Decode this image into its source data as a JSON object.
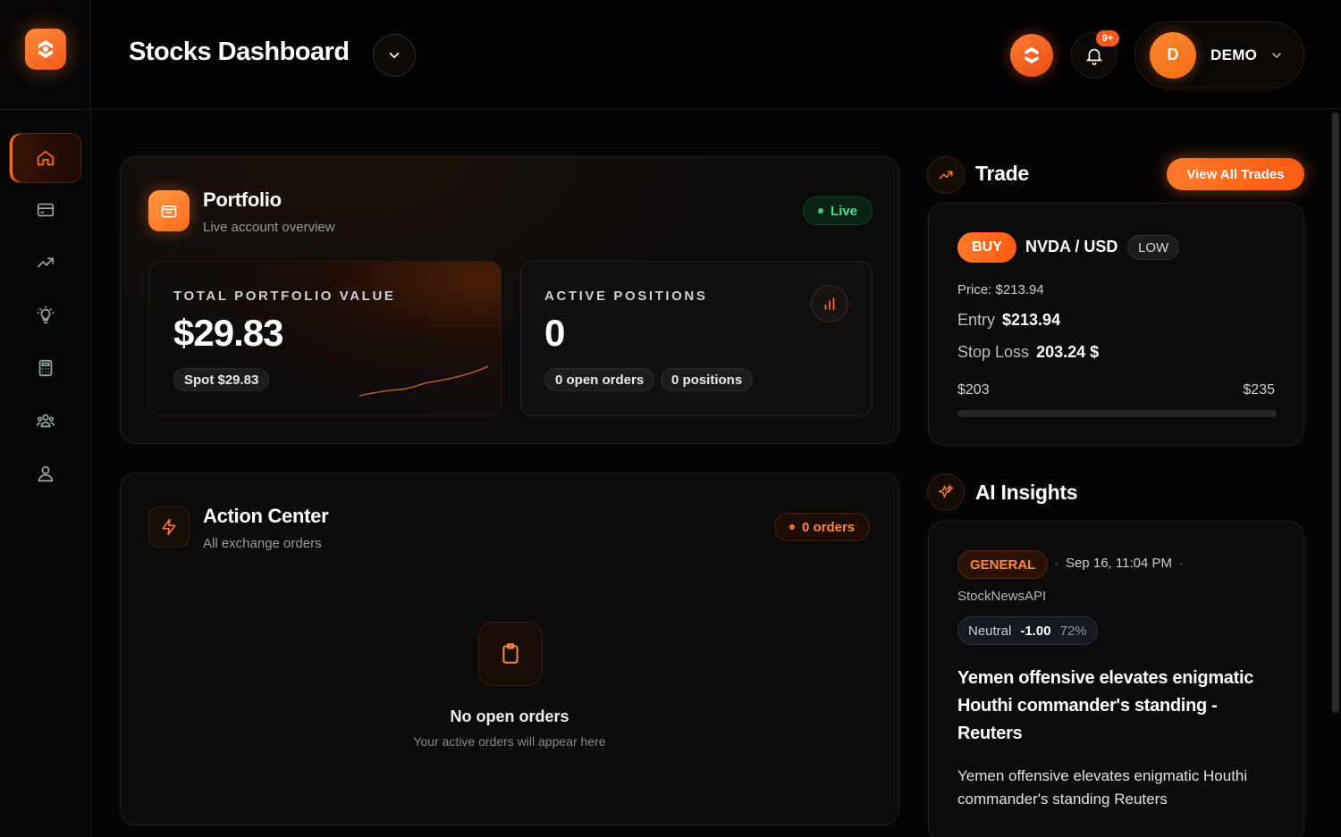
{
  "header": {
    "title": "Stocks Dashboard",
    "notifications_badge": "9+",
    "user": {
      "initial": "D",
      "name": "DEMO"
    }
  },
  "sidebar": {
    "items": [
      {
        "name": "home",
        "icon": "home-icon",
        "active": true
      },
      {
        "name": "cards",
        "icon": "credit-card-icon"
      },
      {
        "name": "trades",
        "icon": "trending-up-icon"
      },
      {
        "name": "insights",
        "icon": "lightbulb-icon"
      },
      {
        "name": "calculator",
        "icon": "calculator-icon"
      },
      {
        "name": "community",
        "icon": "users-icon"
      },
      {
        "name": "profile",
        "icon": "user-icon"
      }
    ]
  },
  "portfolio": {
    "title": "Portfolio",
    "subtitle": "Live account overview",
    "status": "Live",
    "total": {
      "label": "TOTAL PORTFOLIO VALUE",
      "value": "$29.83",
      "chip": "Spot $29.83"
    },
    "positions": {
      "label": "ACTIVE POSITIONS",
      "value": "0",
      "chip_orders": "0 open orders",
      "chip_positions": "0 positions"
    }
  },
  "action_center": {
    "title": "Action Center",
    "subtitle": "All exchange orders",
    "orders_badge": "0 orders",
    "empty_title": "No open orders",
    "empty_subtitle": "Your active orders will appear here"
  },
  "trade": {
    "title": "Trade",
    "view_all": "View All Trades",
    "side": "BUY",
    "pair": "NVDA / USD",
    "risk": "LOW",
    "price": "Price: $213.94",
    "entry_label": "Entry",
    "entry_value": "$213.94",
    "stop_label": "Stop Loss",
    "stop_value": "203.24 $",
    "range_low": "$203",
    "range_high": "$235",
    "range_fill_fraction": 0.0
  },
  "ai_insights": {
    "title": "AI Insights",
    "tag": "GENERAL",
    "date": "Sep 16, 11:04 PM",
    "source": "StockNewsAPI",
    "sentiment_label": "Neutral",
    "sentiment_score": "-1.00",
    "sentiment_confidence": "72%",
    "headline": "Yemen offensive elevates enigmatic Houthi commander's standing - Reuters",
    "description": "Yemen offensive elevates enigmatic Houthi commander's standing  Reuters"
  },
  "colors": {
    "accent": "#ff6a1f",
    "live": "#34d27a",
    "background": "#050505"
  }
}
